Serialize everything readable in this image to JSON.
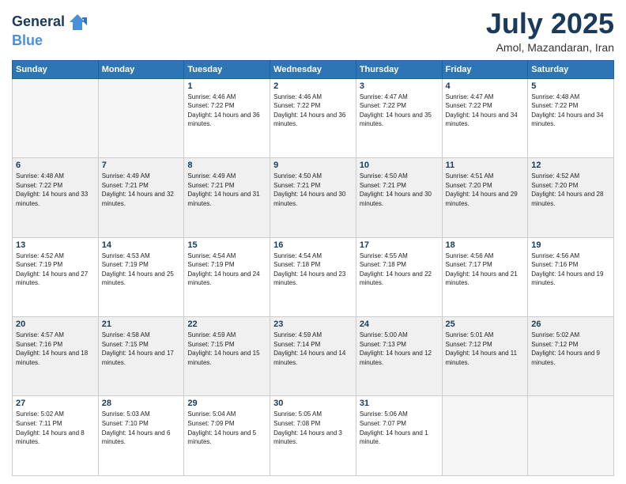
{
  "header": {
    "logo_line1": "General",
    "logo_line2": "Blue",
    "month_year": "July 2025",
    "location": "Amol, Mazandaran, Iran"
  },
  "weekdays": [
    "Sunday",
    "Monday",
    "Tuesday",
    "Wednesday",
    "Thursday",
    "Friday",
    "Saturday"
  ],
  "weeks": [
    [
      {
        "day": "",
        "info": ""
      },
      {
        "day": "",
        "info": ""
      },
      {
        "day": "1",
        "info": "Sunrise: 4:46 AM\nSunset: 7:22 PM\nDaylight: 14 hours and 36 minutes."
      },
      {
        "day": "2",
        "info": "Sunrise: 4:46 AM\nSunset: 7:22 PM\nDaylight: 14 hours and 36 minutes."
      },
      {
        "day": "3",
        "info": "Sunrise: 4:47 AM\nSunset: 7:22 PM\nDaylight: 14 hours and 35 minutes."
      },
      {
        "day": "4",
        "info": "Sunrise: 4:47 AM\nSunset: 7:22 PM\nDaylight: 14 hours and 34 minutes."
      },
      {
        "day": "5",
        "info": "Sunrise: 4:48 AM\nSunset: 7:22 PM\nDaylight: 14 hours and 34 minutes."
      }
    ],
    [
      {
        "day": "6",
        "info": "Sunrise: 4:48 AM\nSunset: 7:22 PM\nDaylight: 14 hours and 33 minutes."
      },
      {
        "day": "7",
        "info": "Sunrise: 4:49 AM\nSunset: 7:21 PM\nDaylight: 14 hours and 32 minutes."
      },
      {
        "day": "8",
        "info": "Sunrise: 4:49 AM\nSunset: 7:21 PM\nDaylight: 14 hours and 31 minutes."
      },
      {
        "day": "9",
        "info": "Sunrise: 4:50 AM\nSunset: 7:21 PM\nDaylight: 14 hours and 30 minutes."
      },
      {
        "day": "10",
        "info": "Sunrise: 4:50 AM\nSunset: 7:21 PM\nDaylight: 14 hours and 30 minutes."
      },
      {
        "day": "11",
        "info": "Sunrise: 4:51 AM\nSunset: 7:20 PM\nDaylight: 14 hours and 29 minutes."
      },
      {
        "day": "12",
        "info": "Sunrise: 4:52 AM\nSunset: 7:20 PM\nDaylight: 14 hours and 28 minutes."
      }
    ],
    [
      {
        "day": "13",
        "info": "Sunrise: 4:52 AM\nSunset: 7:19 PM\nDaylight: 14 hours and 27 minutes."
      },
      {
        "day": "14",
        "info": "Sunrise: 4:53 AM\nSunset: 7:19 PM\nDaylight: 14 hours and 25 minutes."
      },
      {
        "day": "15",
        "info": "Sunrise: 4:54 AM\nSunset: 7:19 PM\nDaylight: 14 hours and 24 minutes."
      },
      {
        "day": "16",
        "info": "Sunrise: 4:54 AM\nSunset: 7:18 PM\nDaylight: 14 hours and 23 minutes."
      },
      {
        "day": "17",
        "info": "Sunrise: 4:55 AM\nSunset: 7:18 PM\nDaylight: 14 hours and 22 minutes."
      },
      {
        "day": "18",
        "info": "Sunrise: 4:56 AM\nSunset: 7:17 PM\nDaylight: 14 hours and 21 minutes."
      },
      {
        "day": "19",
        "info": "Sunrise: 4:56 AM\nSunset: 7:16 PM\nDaylight: 14 hours and 19 minutes."
      }
    ],
    [
      {
        "day": "20",
        "info": "Sunrise: 4:57 AM\nSunset: 7:16 PM\nDaylight: 14 hours and 18 minutes."
      },
      {
        "day": "21",
        "info": "Sunrise: 4:58 AM\nSunset: 7:15 PM\nDaylight: 14 hours and 17 minutes."
      },
      {
        "day": "22",
        "info": "Sunrise: 4:59 AM\nSunset: 7:15 PM\nDaylight: 14 hours and 15 minutes."
      },
      {
        "day": "23",
        "info": "Sunrise: 4:59 AM\nSunset: 7:14 PM\nDaylight: 14 hours and 14 minutes."
      },
      {
        "day": "24",
        "info": "Sunrise: 5:00 AM\nSunset: 7:13 PM\nDaylight: 14 hours and 12 minutes."
      },
      {
        "day": "25",
        "info": "Sunrise: 5:01 AM\nSunset: 7:12 PM\nDaylight: 14 hours and 11 minutes."
      },
      {
        "day": "26",
        "info": "Sunrise: 5:02 AM\nSunset: 7:12 PM\nDaylight: 14 hours and 9 minutes."
      }
    ],
    [
      {
        "day": "27",
        "info": "Sunrise: 5:02 AM\nSunset: 7:11 PM\nDaylight: 14 hours and 8 minutes."
      },
      {
        "day": "28",
        "info": "Sunrise: 5:03 AM\nSunset: 7:10 PM\nDaylight: 14 hours and 6 minutes."
      },
      {
        "day": "29",
        "info": "Sunrise: 5:04 AM\nSunset: 7:09 PM\nDaylight: 14 hours and 5 minutes."
      },
      {
        "day": "30",
        "info": "Sunrise: 5:05 AM\nSunset: 7:08 PM\nDaylight: 14 hours and 3 minutes."
      },
      {
        "day": "31",
        "info": "Sunrise: 5:06 AM\nSunset: 7:07 PM\nDaylight: 14 hours and 1 minute."
      },
      {
        "day": "",
        "info": ""
      },
      {
        "day": "",
        "info": ""
      }
    ]
  ]
}
